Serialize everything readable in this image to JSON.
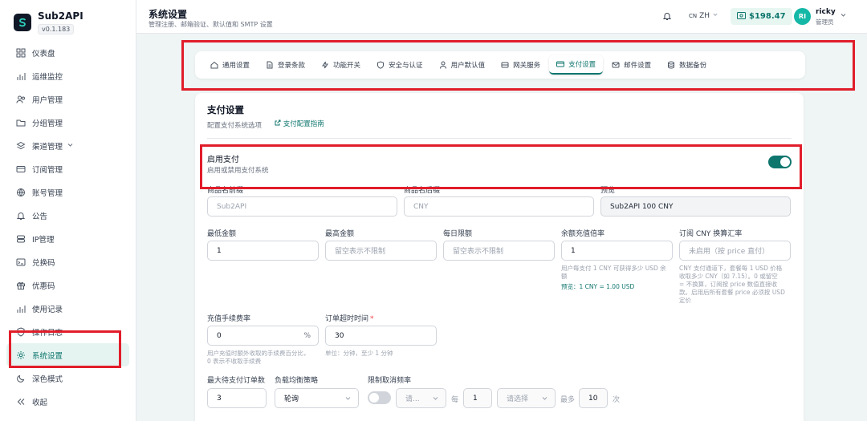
{
  "brand": {
    "name": "Sub2API",
    "version": "v0.1.183"
  },
  "sidebar": {
    "items": [
      {
        "label": "仪表盘",
        "icon": "dashboard-icon"
      },
      {
        "label": "运维监控",
        "icon": "chart-bar-icon"
      },
      {
        "label": "用户管理",
        "icon": "users-icon"
      },
      {
        "label": "分组管理",
        "icon": "folder-icon"
      },
      {
        "label": "渠道管理",
        "icon": "layers-icon"
      },
      {
        "label": "订阅管理",
        "icon": "credit-card-icon"
      },
      {
        "label": "账号管理",
        "icon": "globe-icon"
      },
      {
        "label": "公告",
        "icon": "bell-icon"
      },
      {
        "label": "IP管理",
        "icon": "server-icon"
      },
      {
        "label": "兑换码",
        "icon": "terminal-icon"
      },
      {
        "label": "优惠码",
        "icon": "gift-icon"
      },
      {
        "label": "使用记录",
        "icon": "chart-bar-icon"
      },
      {
        "label": "操作日志",
        "icon": "shield-icon"
      },
      {
        "label": "系统设置",
        "icon": "gear-icon"
      },
      {
        "label": "深色模式",
        "icon": "moon-icon"
      },
      {
        "label": "收起",
        "icon": "chevrons-left-icon"
      }
    ]
  },
  "header": {
    "title": "系统设置",
    "subtitle": "管理注册、邮箱验证、默认值和 SMTP 设置",
    "lang_flag": "CN",
    "lang": "ZH",
    "balance": "$198.47",
    "avatar": "RI",
    "user_name": "ricky",
    "user_role": "管理员"
  },
  "tabs": [
    {
      "label": "通用设置",
      "icon": "home-icon"
    },
    {
      "label": "登录条款",
      "icon": "document-icon"
    },
    {
      "label": "功能开关",
      "icon": "zap-icon"
    },
    {
      "label": "安全与认证",
      "icon": "shield-icon"
    },
    {
      "label": "用户默认值",
      "icon": "user-icon"
    },
    {
      "label": "网关服务",
      "icon": "server-icon"
    },
    {
      "label": "支付设置",
      "icon": "credit-card-icon"
    },
    {
      "label": "邮件设置",
      "icon": "mail-icon"
    },
    {
      "label": "数据备份",
      "icon": "database-icon"
    }
  ],
  "active_tab": "支付设置",
  "card": {
    "title": "支付设置",
    "subtitle": "配置支付系统选项",
    "guide_link": "支付配置指南",
    "enable": {
      "title": "启用支付",
      "subtitle": "启用或禁用支付系统"
    },
    "product_prefix": {
      "label": "商品名前缀",
      "placeholder": "Sub2API"
    },
    "product_suffix": {
      "label": "商品名后缀",
      "placeholder": "CNY"
    },
    "preview": {
      "label": "预览",
      "value": "Sub2API 100 CNY"
    },
    "min_amount": {
      "label": "最低金额",
      "value": "1"
    },
    "max_amount": {
      "label": "最高金额",
      "placeholder": "留空表示不限制"
    },
    "daily_limit": {
      "label": "每日限额",
      "placeholder": "留空表示不限制"
    },
    "balance_rate": {
      "label": "余额充值倍率",
      "value": "1",
      "hint_line1": "用户每支付 1 CNY 可获得多少 USD 余",
      "hint_line2": "额",
      "preview": "预览：1 CNY = 1.00 USD"
    },
    "sub_cny_rate": {
      "label": "订阅 CNY 换算汇率",
      "placeholder": "未启用（按 price 直付）",
      "hint_lines": [
        "CNY 支付通道下，套餐每 1 USD 价格",
        "收取多少 CNY（如 7.15）。0 或留空",
        "= 不换算，订阅按 price 数值直接收",
        "款。启用后所有套餐 price 必须按 USD",
        "定价"
      ]
    },
    "fee_rate": {
      "label": "充值手续费率",
      "value": "0",
      "suffix": "%",
      "hint_line1": "用户充值时额外收取的手续费百分比，",
      "hint_line2": "0 表示不收取手续费"
    },
    "order_timeout": {
      "label": "订单超时时间",
      "required": "*",
      "value": "30",
      "hint": "单位：分钟，至少 1 分钟"
    },
    "max_pending": {
      "label": "最大待支付订单数",
      "value": "3"
    },
    "lb_strategy": {
      "label": "负载均衡策略",
      "value": "轮询"
    },
    "cancel_rate": {
      "label": "限制取消频率",
      "period_select": "请...",
      "every": "每",
      "every_value": "1",
      "unit_select": "请选择",
      "max_label": "最多",
      "max_value": "10",
      "times": "次"
    }
  }
}
